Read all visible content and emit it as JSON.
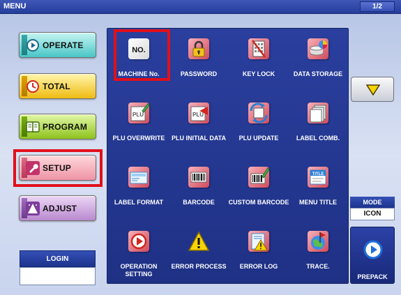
{
  "window": {
    "title": "MENU",
    "page_indicator": "1/2"
  },
  "menu": {
    "items": [
      {
        "label": "OPERATE",
        "icon": "play-circle-icon"
      },
      {
        "label": "TOTAL",
        "icon": "clock-icon"
      },
      {
        "label": "PROGRAM",
        "icon": "book-icon"
      },
      {
        "label": "SETUP",
        "icon": "wrench-icon",
        "selected": true
      },
      {
        "label": "ADJUST",
        "icon": "adjust-icon"
      }
    ]
  },
  "login": {
    "label": "LOGIN",
    "value": ""
  },
  "grid": {
    "items": [
      {
        "label": "MACHINE No.",
        "icon": "machine-number-icon",
        "icon_text": "NO.",
        "selected": true
      },
      {
        "label": "PASSWORD",
        "icon": "padlock-icon"
      },
      {
        "label": "KEY LOCK",
        "icon": "keylock-icon"
      },
      {
        "label": "DATA STORAGE",
        "icon": "data-storage-icon"
      },
      {
        "label": "PLU OVERWRITE",
        "icon": "plu-overwrite-icon",
        "icon_text": "PLU"
      },
      {
        "label": "PLU INITIAL DATA",
        "icon": "plu-initial-icon",
        "icon_text": "PLU"
      },
      {
        "label": "PLU UPDATE",
        "icon": "plu-update-icon"
      },
      {
        "label": "LABEL COMB.",
        "icon": "label-comb-icon"
      },
      {
        "label": "LABEL FORMAT",
        "icon": "label-format-icon"
      },
      {
        "label": "BARCODE",
        "icon": "barcode-icon"
      },
      {
        "label": "CUSTOM BARCODE",
        "icon": "custom-barcode-icon"
      },
      {
        "label": "MENU TITLE",
        "icon": "menu-title-icon",
        "icon_text": "TITLE"
      },
      {
        "label": "OPERATION SETTING",
        "icon": "operation-setting-icon"
      },
      {
        "label": "ERROR PROCESS",
        "icon": "warning-icon"
      },
      {
        "label": "ERROR LOG",
        "icon": "error-log-icon"
      },
      {
        "label": "TRACE.",
        "icon": "trace-icon"
      }
    ]
  },
  "scroll": {
    "down_icon": "triangle-down-icon"
  },
  "mode": {
    "label": "MODE",
    "value": "ICON"
  },
  "prepack": {
    "label": "PREPACK",
    "icon": "play-circle-icon"
  },
  "colors": {
    "accent": "#e0101a",
    "panel": "#233790",
    "title_bar": "#2c45a8"
  }
}
